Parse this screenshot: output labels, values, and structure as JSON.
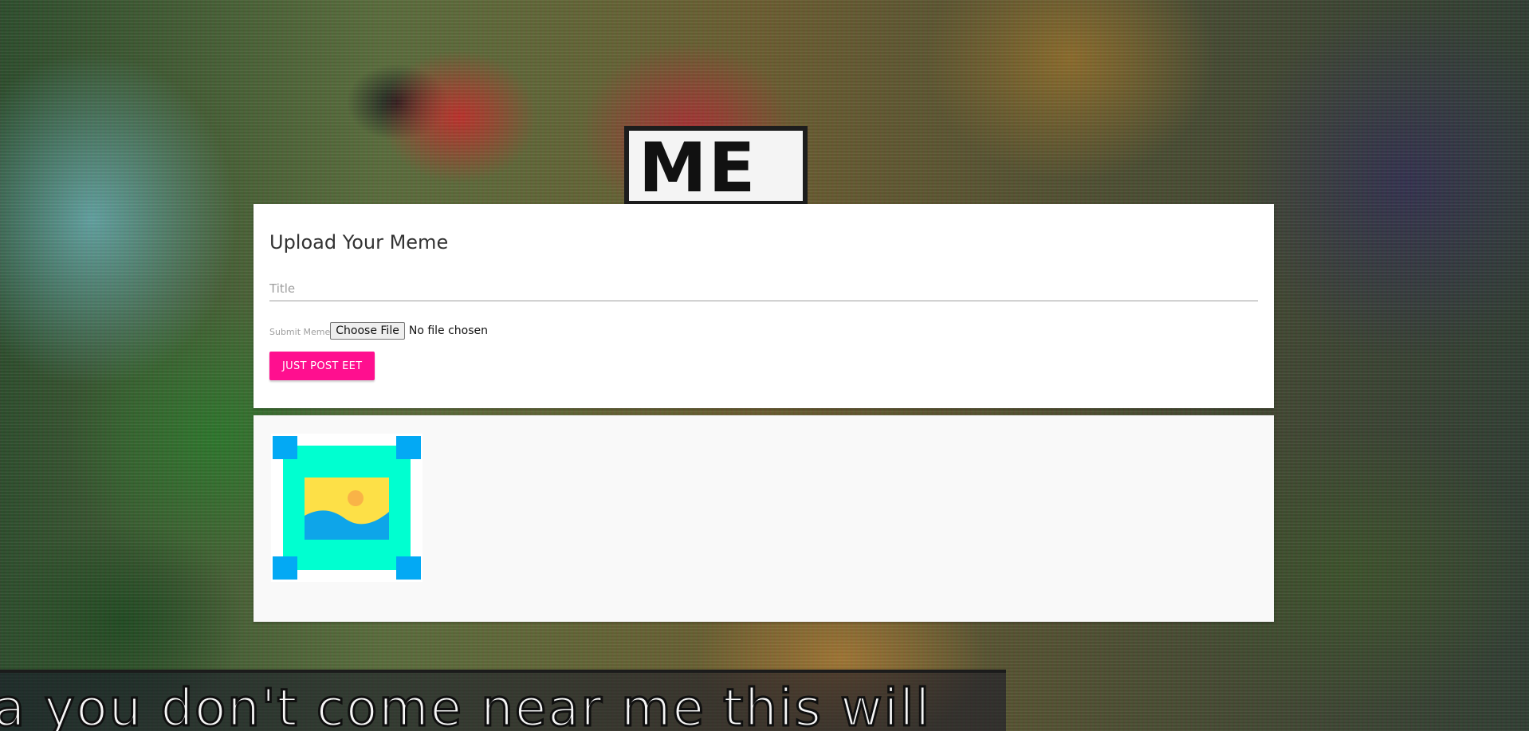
{
  "background": {
    "sign_text": "ME",
    "subtitle_text": "a you don't come near me this will"
  },
  "upload": {
    "heading": "Upload Your Meme",
    "title_placeholder": "Title",
    "title_value": "",
    "file_label": "Submit Meme",
    "file_button_label": "Choose File",
    "file_status": "No file chosen",
    "submit_label": "JUST POST EET"
  },
  "gallery": {
    "items": [
      {
        "icon": "image-placeholder-icon"
      }
    ]
  },
  "colors": {
    "accent": "#ff0f8f",
    "placeholder_frame": "#00ffd0",
    "placeholder_corners": "#03a9f4",
    "placeholder_sky": "#fde047",
    "placeholder_sun": "#f9b347",
    "placeholder_water": "#0ea5e9"
  }
}
